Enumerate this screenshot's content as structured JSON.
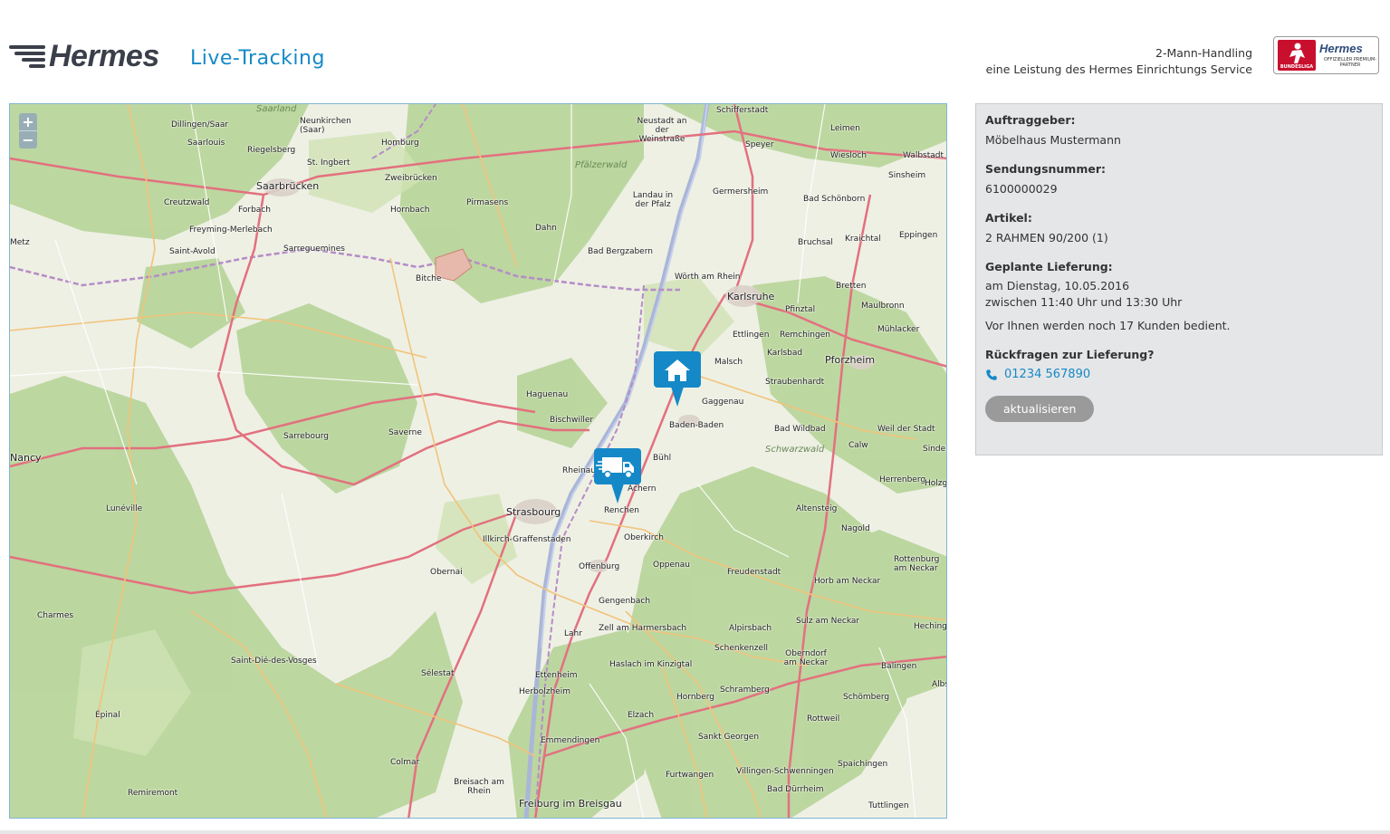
{
  "header": {
    "logo_text": "Hermes",
    "page_title": "Live-Tracking",
    "service_line1": "2-Mann-Handling",
    "service_line2": "eine Leistung des Hermes Einrichtungs Service",
    "badge_bl": "BUNDESLIGA",
    "badge_hermes": "Hermes",
    "badge_sub": "OFFIZIELLER PREMIUM-PARTNER"
  },
  "map": {
    "zoom_in": "+",
    "zoom_out": "−",
    "markers": [
      {
        "type": "destination",
        "icon": "home-icon",
        "near": "Rastatt"
      },
      {
        "type": "vehicle",
        "icon": "truck-icon",
        "near": "Renchen"
      }
    ],
    "cities": [
      "Saarland",
      "Dillingen/Saar",
      "Neunkirchen (Saar)",
      "Saarlouis",
      "Homburg",
      "Riegelsberg",
      "St. Ingbert",
      "Saarbrücken",
      "Zweibrücken",
      "Creutzwald",
      "Forbach",
      "Hornbach",
      "Pirmasens",
      "Freyming-Merlebach",
      "Saint-Avold",
      "Sarreguemines",
      "Bitche",
      "Dahn",
      "Pfälzerwald",
      "Neustadt an der Weinstraße",
      "Landau in der Pfalz",
      "Bad Bergzabern",
      "Schifferstadt",
      "Speyer",
      "Germersheim",
      "Wörth am Rhein",
      "Karlsruhe",
      "Leimen",
      "Wiesloch",
      "Walbstadt",
      "Sinsheim",
      "Bad Schönborn",
      "Bruchsal",
      "Kraichtal",
      "Eppingen",
      "Bretten",
      "Pfinztal",
      "Maulbronn",
      "Mühlacker",
      "Ettlingen",
      "Remchingen",
      "Karlsbad",
      "Malsch",
      "Pforzheim",
      "Straubenhardt",
      "Gaggenau",
      "Baden-Baden",
      "Bad Wildbad",
      "Weil der Stadt",
      "Schwarzwald",
      "Calw",
      "Sindel",
      "Haguenau",
      "Bischwiller",
      "Sarrebourg",
      "Saverne",
      "Rheinau",
      "Bühl",
      "Achern",
      "Renchen",
      "Strasbourg",
      "Illkirch-Graffenstaden",
      "Oberkirch",
      "Obernai",
      "Offenburg",
      "Oppenau",
      "Freudenstadt",
      "Altensteig",
      "Herrenberg",
      "Nagold",
      "Rottenburg am Neckar",
      "Horb am Neckar",
      "Lunéville",
      "Gengenbach",
      "Zell am Harmersbach",
      "Lahr",
      "Alpirsbach",
      "Sulz am Neckar",
      "Schenkenzell",
      "Oberndorf am Neckar",
      "Charmes",
      "Saint-Dié-des-Vosges",
      "Sélestat",
      "Ettenheim",
      "Haslach im Kinzigtal",
      "Schramberg",
      "Herbolzheim",
      "Hornberg",
      "Balingen",
      "Schömberg",
      "Épinal",
      "Elzach",
      "Rottweil",
      "Emmendingen",
      "Sankt Georgen",
      "Colmar",
      "Villingen-Schwenningen",
      "Spaichingen",
      "Breisach am Rhein",
      "Furtwangen",
      "Remiremont",
      "Freiburg im Breisgau",
      "Bad Dürrheim",
      "Tuttlingen",
      "Metz",
      "Nancy",
      "Holzg",
      "Hechinge",
      "Albs"
    ]
  },
  "panel": {
    "client_label": "Auftraggeber:",
    "client_value": "Möbelhaus Mustermann",
    "shipment_label": "Sendungsnummer:",
    "shipment_value": "6100000029",
    "article_label": "Artikel:",
    "article_value": "2 RAHMEN 90/200 (1)",
    "delivery_label": "Geplante Lieferung:",
    "delivery_date": "am Dienstag, 10.05.2016",
    "delivery_window": "zwischen 11:40 Uhr und 13:30 Uhr",
    "queue_note": "Vor Ihnen werden noch 17 Kunden bedient.",
    "questions_label": "Rückfragen zur Lieferung?",
    "phone": "01234 567890",
    "refresh_button": "aktualisieren"
  },
  "colors": {
    "accent": "#1589c7",
    "marker": "#1589c7",
    "panel_bg": "#e5e6e8",
    "button_bg": "#9a9a9a"
  }
}
